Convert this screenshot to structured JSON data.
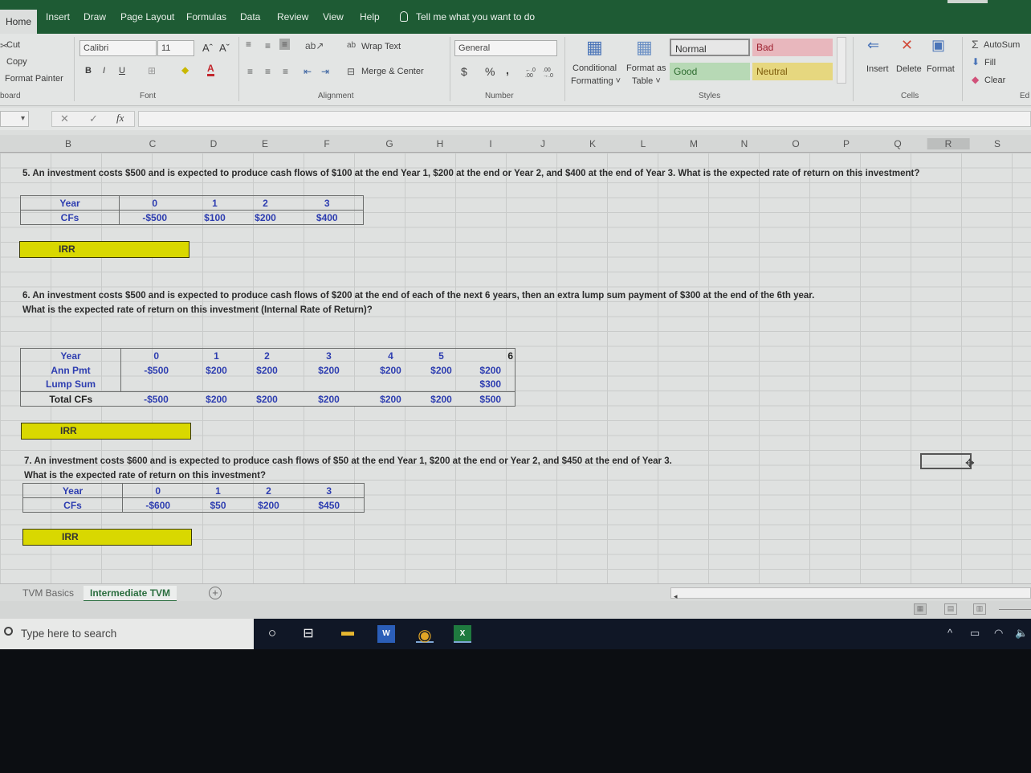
{
  "ribbon_tabs": [
    "Home",
    "Insert",
    "Draw",
    "Page Layout",
    "Formulas",
    "Data",
    "Review",
    "View",
    "Help"
  ],
  "active_tab": "Home",
  "tell_me": "Tell me what you want to do",
  "clipboard": {
    "cut": "Cut",
    "copy": "Copy",
    "format_painter": "Format Painter",
    "group": "board"
  },
  "font": {
    "name": "Calibri",
    "size": "11",
    "bold": "B",
    "italic": "I",
    "underline": "U",
    "grow": "Aˆ",
    "shrink": "Aˇ",
    "group": "Font"
  },
  "alignment": {
    "wrap_text": "Wrap Text",
    "merge_center": "Merge & Center",
    "group": "Alignment"
  },
  "number": {
    "format": "General",
    "currency": "$",
    "percent": "%",
    "comma": ",",
    "inc_decimal": "←.0 .00",
    "dec_decimal": ".00 →.0",
    "group": "Number"
  },
  "styles": {
    "conditional_formatting": [
      "Conditional",
      "Formatting ˅"
    ],
    "format_as_table": [
      "Format as",
      "Table ˅"
    ],
    "cells": [
      {
        "label": "Normal",
        "bg": "#e7e7e7",
        "fg": "#333333"
      },
      {
        "label": "Bad",
        "bg": "#e8b7bd",
        "fg": "#9c1f2e"
      },
      {
        "label": "Good",
        "bg": "#b7d9b5",
        "fg": "#2c6b2f"
      },
      {
        "label": "Neutral",
        "bg": "#e6d77f",
        "fg": "#7d5b0a"
      }
    ],
    "group": "Styles"
  },
  "cells_group": {
    "insert": "Insert",
    "delete": "Delete",
    "format": "Format",
    "group": "Cells"
  },
  "editing": {
    "autosum": "AutoSum",
    "fill": "Fill",
    "clear": "Clear",
    "group": "Ed"
  },
  "formula_bar": {
    "fx": "fx",
    "cancel": "✕",
    "enter": "✓",
    "value": ""
  },
  "columns": [
    "B",
    "C",
    "D",
    "E",
    "F",
    "G",
    "H",
    "I",
    "J",
    "K",
    "L",
    "M",
    "N",
    "O",
    "P",
    "Q",
    "R",
    "S"
  ],
  "selected_column": "R",
  "problems": {
    "p5": {
      "question": "5. An investment costs $500 and is expected to produce cash flows of $100 at the end Year 1, $200 at the end or Year 2, and $400 at the end of Year 3.  What is the expected rate of return on this investment?",
      "year_label": "Year",
      "cf_label": "CFs",
      "years": [
        "0",
        "1",
        "2",
        "3"
      ],
      "cfs": [
        "-$500",
        "$100",
        "$200",
        "$400"
      ],
      "irr_label": "IRR"
    },
    "p6": {
      "question_line1": "6. An investment costs $500 and is expected to produce cash flows of $200 at the end of each of the next 6 years, then an extra lump sum payment of $300 at the end of the 6th year.",
      "question_line2": "What is the expected rate of return on this investment (Internal Rate of Return)?",
      "year_label": "Year",
      "ann_label": "Ann Pmt",
      "lump_label": "Lump Sum",
      "total_label": "Total CFs",
      "years": [
        "0",
        "1",
        "2",
        "3",
        "4",
        "5",
        "6"
      ],
      "ann_pmt": [
        "-$500",
        "$200",
        "$200",
        "$200",
        "$200",
        "$200",
        "$200"
      ],
      "lump_sum": [
        "",
        "",
        "",
        "",
        "",
        "",
        "$300"
      ],
      "total_cfs": [
        "-$500",
        "$200",
        "$200",
        "$200",
        "$200",
        "$200",
        "$500"
      ],
      "irr_label": "IRR"
    },
    "p7": {
      "question_line1": "7. An investment costs $600 and is expected to produce cash flows of $50 at the end Year 1, $200 at the end or Year 2, and $450 at the end of Year 3.",
      "question_line2": "What is the expected rate of return on this investment?",
      "year_label": "Year",
      "cf_label": "CFs",
      "years": [
        "0",
        "1",
        "2",
        "3"
      ],
      "cfs": [
        "-$600",
        "$50",
        "$200",
        "$450"
      ],
      "irr_label": "IRR"
    }
  },
  "sheet_tabs": [
    "TVM Basics",
    "Intermediate TVM"
  ],
  "active_sheet": "Intermediate TVM",
  "taskbar": {
    "search_placeholder": "Type here to search"
  }
}
